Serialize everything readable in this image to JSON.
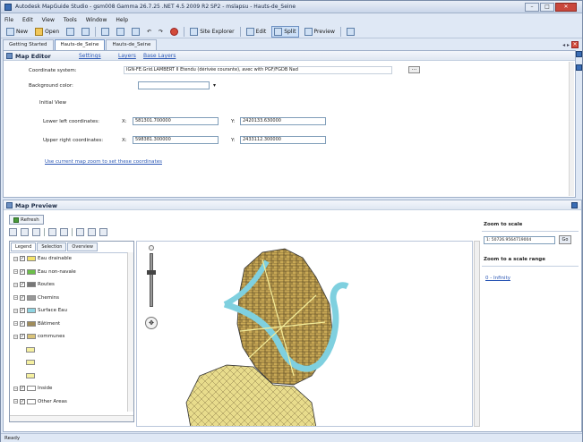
{
  "window": {
    "title": "Autodesk MapGuide Studio - gsm008 Gamma 26.7.25 .NET 4.5 2009 R2 SP2 - mslapsu - Hauts-de_Seine",
    "controls": [
      "–",
      "□",
      "✕"
    ]
  },
  "menu": [
    "File",
    "Edit",
    "View",
    "Tools",
    "Window",
    "Help"
  ],
  "toolbar": {
    "new": "New",
    "open": "Open",
    "site_explorer": "Site Explorer",
    "edit": "Edit",
    "split": "Split",
    "preview": "Preview"
  },
  "tabs": [
    "Getting Started",
    "Hauts-de_Seine",
    "Hauts-de_Seine"
  ],
  "editor": {
    "title": "Map Editor",
    "links": [
      "Settings",
      "Layers",
      "Base Layers"
    ],
    "coord_label": "Coordinate system:",
    "coord_value": "IGN-FE.Grid.LAMBERT II Étendu (dérivée courante), avec with PGF/FGDB Nad",
    "bg_label": "Background color:",
    "initial_view": "Initial View",
    "lower_left_label": "Lower left coordinates:",
    "upper_right_label": "Upper right coordinates:",
    "x": "X:",
    "y": "Y:",
    "ll_x": "581301.700000",
    "ll_y": "2420133.630000",
    "ur_x": "598381.300000",
    "ur_y": "2433112.300000",
    "use_current": "Use current map zoom to set these coordinates"
  },
  "preview": {
    "title": "Map Preview",
    "refresh": "Refresh",
    "legend_tabs": [
      "Legend",
      "Selection",
      "Overview"
    ],
    "layers": [
      {
        "label": "Eau drainable",
        "color": "#f4e36a"
      },
      {
        "label": "Eau non-navale",
        "color": "#6cc04a"
      },
      {
        "label": "Routes",
        "color": "#777777"
      },
      {
        "label": "Chemins",
        "color": "#999999"
      },
      {
        "label": "Surface Eau",
        "color": "#8fd4e2"
      },
      {
        "label": "Bâtiment",
        "color": "#a08c5a"
      },
      {
        "label": "communes",
        "color": "#d9c37a"
      },
      {
        "label": "",
        "color": "#f5f0a0"
      },
      {
        "label": "",
        "color": "#f5f0a0"
      },
      {
        "label": "",
        "color": "#f5f0a0"
      },
      {
        "label": "Inside",
        "color": "#ffffff"
      },
      {
        "label": "Other Areas",
        "color": "#ffffff"
      }
    ],
    "zoom_label": "Zoom to scale",
    "scale_value": "1: 50726.9564719004",
    "go": "Go",
    "zoom_range_label": "Zoom to a scale range",
    "infinity_link": "0 - Infinity"
  },
  "status": "Ready"
}
